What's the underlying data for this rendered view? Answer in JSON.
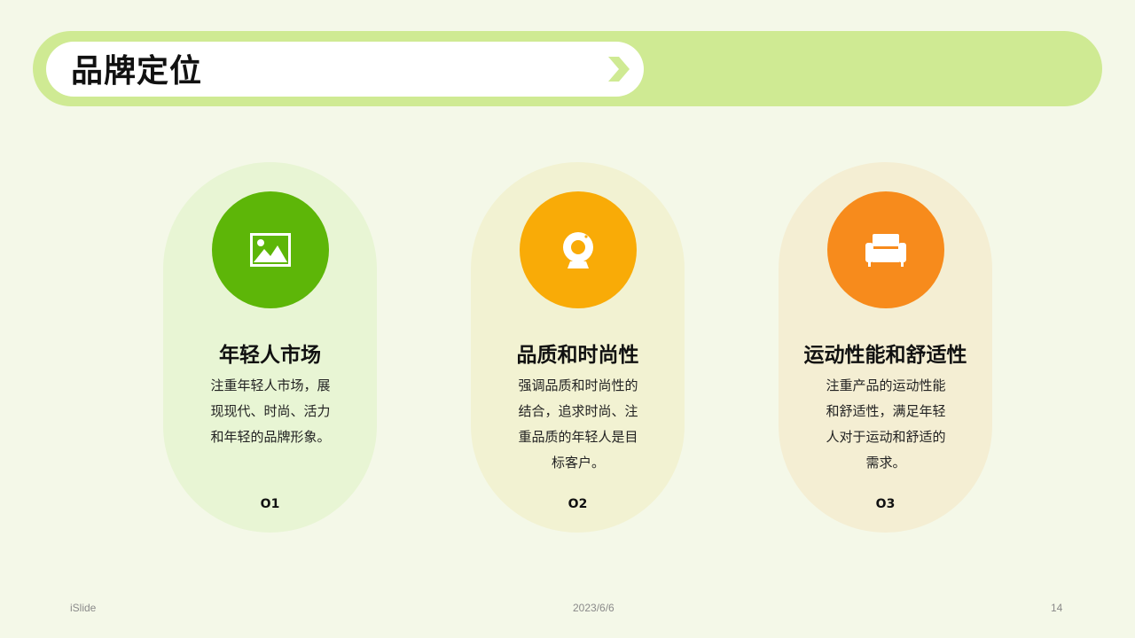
{
  "header": {
    "title": "品牌定位"
  },
  "colors": {
    "background": "#f4f8e8",
    "header_band": "#cfea93",
    "chevron": "#cfea93",
    "circle_1": "#5db608",
    "circle_2": "#f9ab07",
    "circle_3": "#f78b1c"
  },
  "cards": [
    {
      "icon": "image-icon",
      "title": "年轻人市场",
      "description": "注重年轻人市场，展现现代、时尚、活力和年轻的品牌形象。",
      "number": "O1"
    },
    {
      "icon": "webcam-icon",
      "title": "品质和时尚性",
      "description": "强调品质和时尚性的结合，追求时尚、注重品质的年轻人是目标客户。",
      "number": "O2"
    },
    {
      "icon": "sofa-icon",
      "title": "运动性能和舒适性",
      "description": "注重产品的运动性能和舒适性，满足年轻人对于运动和舒适的需求。",
      "number": "O3"
    }
  ],
  "footer": {
    "left": "iSlide",
    "center": "2023/6/6",
    "right": "14"
  }
}
